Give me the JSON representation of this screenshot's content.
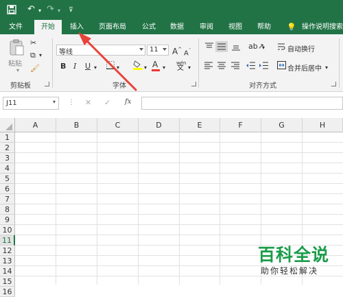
{
  "tabs": [
    "文件",
    "开始",
    "插入",
    "页面布局",
    "公式",
    "数据",
    "审阅",
    "视图",
    "帮助",
    "操作说明搜索"
  ],
  "active_tab": "开始",
  "clipboard": {
    "paste_label": "粘贴",
    "group_label": "剪贴板"
  },
  "font": {
    "name": "等线",
    "size": "11",
    "group_label": "字体",
    "bold": "B",
    "italic": "I",
    "underline": "U",
    "grow": "A",
    "shrink": "A",
    "color_glyph": "A",
    "phonetic": "wén"
  },
  "alignment": {
    "wrap_label": "自动换行",
    "merge_label": "合并后居中",
    "group_label": "对齐方式"
  },
  "formula_bar": {
    "name_box": "J11",
    "fx": "fx",
    "formula": ""
  },
  "columns": [
    "A",
    "B",
    "C",
    "D",
    "E",
    "F",
    "G",
    "H"
  ],
  "rows": [
    "1",
    "2",
    "3",
    "4",
    "5",
    "6",
    "7",
    "8",
    "9",
    "10",
    "11",
    "12",
    "13",
    "14",
    "15",
    "16"
  ],
  "selected_row": "11",
  "colors": {
    "excel_green": "#217346",
    "annotation_red": "#e8443a",
    "watermark_green": "#1a9c4a"
  },
  "watermark": {
    "brand": "百科全说",
    "slogan": "助你轻松解决"
  }
}
